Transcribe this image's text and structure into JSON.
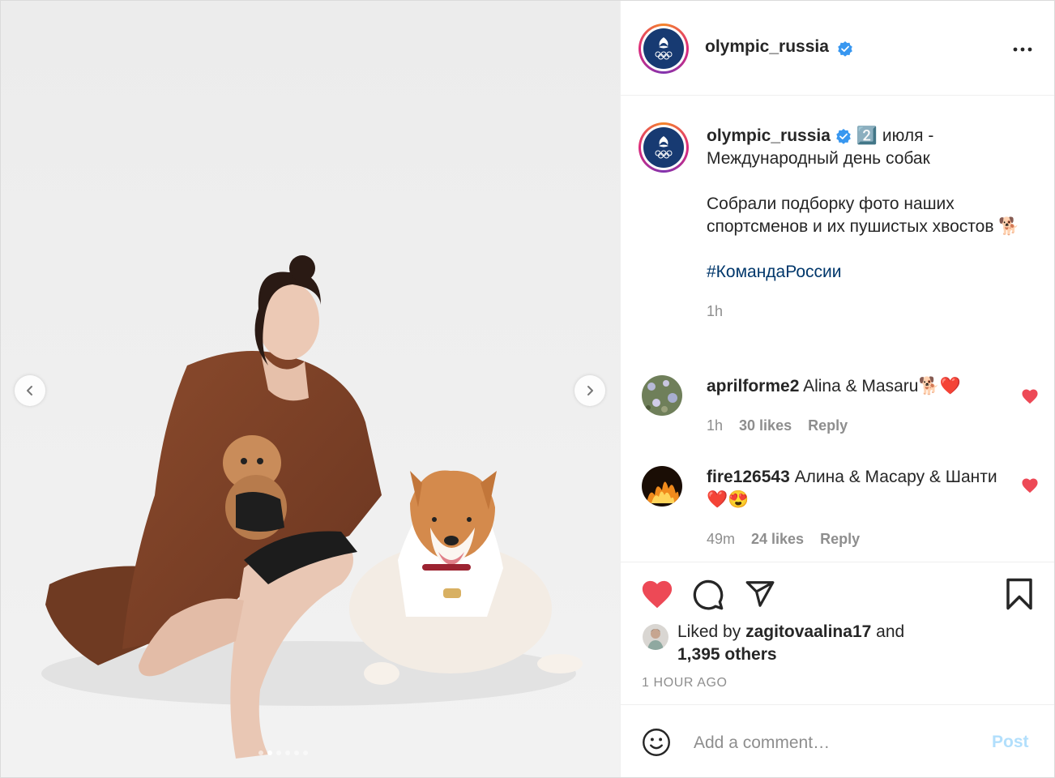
{
  "account": {
    "username": "olympic_russia"
  },
  "carousel": {
    "total": 6,
    "active": 1
  },
  "caption": {
    "line1": "2️⃣ июля - Международный день собак",
    "line2": "Собрали подборку фото наших спортсменов и их пушистых хвостов 🐕",
    "hashtag": "#КомандаРоссии",
    "time": "1h"
  },
  "comments": [
    {
      "username": "aprilforme2",
      "text": "Alina & Masaru🐕❤️",
      "time": "1h",
      "likes": "30 likes",
      "reply": "Reply"
    },
    {
      "username": "fire126543",
      "text": "Алина & Масару & Шанти❤️😍",
      "time": "49m",
      "likes": "24 likes",
      "reply": "Reply"
    }
  ],
  "likes": {
    "prefix": "Liked by",
    "user": "zagitovaalina17",
    "conj": "and",
    "others": "1,395 others"
  },
  "timestamp": "1 HOUR AGO",
  "add_comment": {
    "placeholder": "Add a comment…",
    "post_label": "Post"
  },
  "colors": {
    "like_red": "#ed4956",
    "hashtag": "#00376b",
    "post_disabled": "#b2dffc",
    "logo_blue": "#173a72"
  },
  "icons": [
    "more-icon",
    "heart-icon",
    "comment-icon",
    "share-icon",
    "bookmark-icon",
    "emoji-icon",
    "chevron-left-icon",
    "chevron-right-icon",
    "verified-icon"
  ]
}
